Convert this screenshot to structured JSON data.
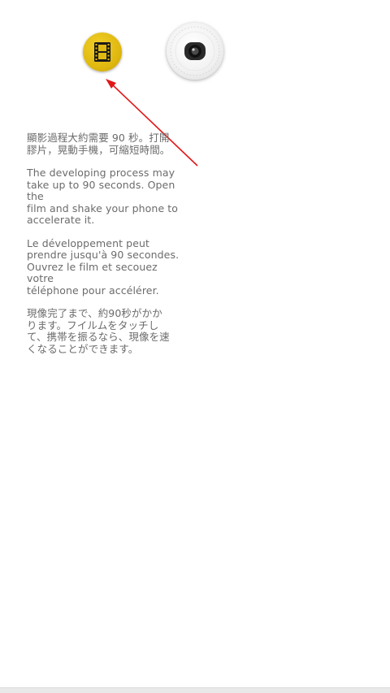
{
  "icons": {
    "film": "film-icon",
    "camera": "camera-lens-icon"
  },
  "colors": {
    "film_button": "#e0b910",
    "arrow": "#e01818",
    "text": "#6b6b6b"
  },
  "instructions": {
    "chinese": "顯影過程大約需要 90 秒。打開\n膠片，晃動手機，可縮短時間。",
    "english": "The developing process may\ntake up to 90 seconds. Open the\nfilm and shake your phone to\naccelerate it.",
    "french": "Le développement peut\nprendre jusqu'à 90 secondes.\nOuvrez le film et secouez votre\ntéléphone pour accélérer.",
    "japanese": "現像完了まで、約90秒がかか\nります。フイルムをタッチし\nて、携帯を振るなら、現像を速\nくなることができます。"
  }
}
